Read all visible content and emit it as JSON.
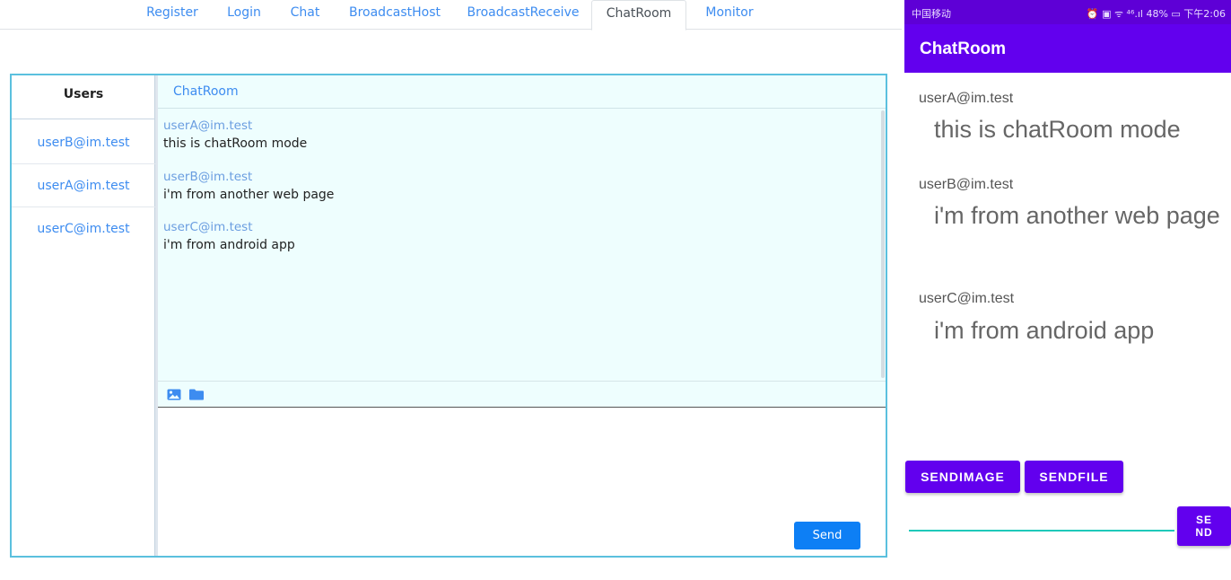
{
  "web": {
    "nav_tabs": [
      {
        "label": "Register"
      },
      {
        "label": "Login"
      },
      {
        "label": "Chat"
      },
      {
        "label": "BroadcastHost"
      },
      {
        "label": "BroadcastReceive"
      },
      {
        "label": "ChatRoom",
        "active": true
      },
      {
        "label": "Monitor"
      }
    ],
    "users_header": "Users",
    "users": [
      "userB@im.test",
      "userA@im.test",
      "userC@im.test"
    ],
    "room_title": "ChatRoom",
    "messages": [
      {
        "user": "userA@im.test",
        "text": "this is chatRoom mode"
      },
      {
        "user": "userB@im.test",
        "text": "i'm from another web page"
      },
      {
        "user": "userC@im.test",
        "text": "i'm from android app"
      }
    ],
    "toolbar_icons": [
      "image-icon",
      "folder-icon"
    ],
    "send_label": "Send"
  },
  "phone": {
    "carrier": "中国移动",
    "status_right": "⏰ ▣ ᯤ ⁴⁶.ıl 48% ▭ 下午2:06",
    "app_title": "ChatRoom",
    "messages": [
      {
        "user": "userA@im.test",
        "text": "this is chatRoom mode"
      },
      {
        "user": "userB@im.test",
        "text": "i'm from another web page"
      },
      {
        "user": "userC@im.test",
        "text": "i'm from android app"
      }
    ],
    "send_image_label": "SENDIMAGE",
    "send_file_label": "SENDFILE",
    "send_label_line1": "SE",
    "send_label_line2": "ND"
  },
  "colors": {
    "link_blue": "#3d8cf0",
    "frame_border": "#5bc0de",
    "chat_bg": "#eefefe",
    "send_button": "#0d7ff5",
    "android_primary": "#6200ee",
    "android_status": "#5e00d6",
    "android_accent": "#1fc9b9"
  }
}
